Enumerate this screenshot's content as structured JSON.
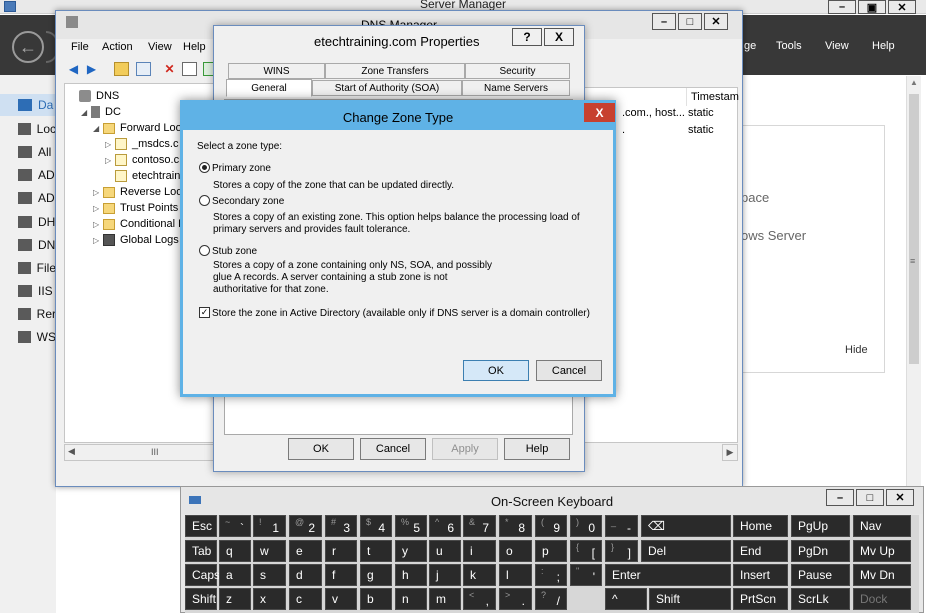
{
  "server_manager": {
    "title": "Server Manager",
    "menus": [
      "ge",
      "Tools",
      "View",
      "Help"
    ],
    "sidebar": [
      {
        "label": "Da",
        "icon": "dashboard-icon",
        "active": true
      },
      {
        "label": "Loc",
        "icon": "local-server-icon"
      },
      {
        "label": "All",
        "icon": "all-servers-icon"
      },
      {
        "label": "AD",
        "icon": "ad-cs-icon"
      },
      {
        "label": "AD",
        "icon": "ad-ds-icon"
      },
      {
        "label": "DH",
        "icon": "dhcp-icon"
      },
      {
        "label": "DN",
        "icon": "dns-icon"
      },
      {
        "label": "File",
        "icon": "file-services-icon"
      },
      {
        "label": "IIS",
        "icon": "iis-icon"
      },
      {
        "label": "Rer",
        "icon": "remote-access-icon"
      },
      {
        "label": "WS",
        "icon": "wsus-icon"
      }
    ],
    "tile": {
      "line1": "pace",
      "line2": "ows Server",
      "hide": "Hide"
    }
  },
  "dns_manager": {
    "title": "DNS Manager",
    "menus": [
      "File",
      "Action",
      "View",
      "Help"
    ],
    "tree": [
      {
        "label": "DNS",
        "indent": 0,
        "twisty": "",
        "icon": "dns"
      },
      {
        "label": "DC",
        "indent": 1,
        "twisty": "◢",
        "icon": "server"
      },
      {
        "label": "Forward Look",
        "indent": 2,
        "twisty": "◢",
        "icon": "folder"
      },
      {
        "label": "_msdcs.c",
        "indent": 3,
        "twisty": "▷",
        "icon": "zone"
      },
      {
        "label": "contoso.c",
        "indent": 3,
        "twisty": "▷",
        "icon": "zone"
      },
      {
        "label": "etechtrain",
        "indent": 3,
        "twisty": "",
        "icon": "zone"
      },
      {
        "label": "Reverse Look",
        "indent": 2,
        "twisty": "▷",
        "icon": "folder"
      },
      {
        "label": "Trust Points",
        "indent": 2,
        "twisty": "▷",
        "icon": "folder"
      },
      {
        "label": "Conditional F",
        "indent": 2,
        "twisty": "▷",
        "icon": "folder"
      },
      {
        "label": "Global Logs",
        "indent": 2,
        "twisty": "▷",
        "icon": "logs"
      }
    ],
    "list": {
      "header": "Timestam",
      "rows": [
        {
          "data": ".com., host...",
          "timestamp": "static"
        },
        {
          "data": ".",
          "timestamp": "static"
        }
      ]
    }
  },
  "properties": {
    "title": "etechtraining.com Properties",
    "tabs_row1": [
      "WINS",
      "Zone Transfers",
      "Security"
    ],
    "tabs_row2": [
      "General",
      "Start of Authority (SOA)",
      "Name Servers"
    ],
    "selected_tab": "General",
    "help_button": "?",
    "close_button": "X",
    "buttons": {
      "ok": "OK",
      "cancel": "Cancel",
      "apply": "Apply",
      "help": "Help"
    }
  },
  "change_zone": {
    "title": "Change Zone Type",
    "close": "X",
    "prompt": "Select a zone type:",
    "options": [
      {
        "label": "Primary zone",
        "selected": true,
        "desc": [
          "Stores a copy of the zone that can be updated directly."
        ]
      },
      {
        "label": "Secondary zone",
        "selected": false,
        "desc": [
          "Stores a copy of an existing zone. This option helps balance the processing load of",
          "primary servers and provides fault tolerance."
        ]
      },
      {
        "label": "Stub zone",
        "selected": false,
        "desc": [
          "Stores a copy of a zone containing only NS, SOA, and possibly",
          "glue A records. A server containing a stub zone is not",
          "authoritative for that zone."
        ]
      }
    ],
    "ad_checkbox": {
      "label": "Store the zone in Active Directory (available only if DNS server is a domain controller)",
      "checked": true
    },
    "ok": "OK",
    "cancel": "Cancel"
  },
  "keyboard": {
    "title": "On-Screen Keyboard",
    "rows": [
      [
        {
          "l": "Esc"
        },
        {
          "s": "~",
          "m": "`"
        },
        {
          "s": "!",
          "m": "1"
        },
        {
          "s": "@",
          "m": "2"
        },
        {
          "s": "#",
          "m": "3"
        },
        {
          "s": "$",
          "m": "4"
        },
        {
          "s": "%",
          "m": "5"
        },
        {
          "s": "^",
          "m": "6"
        },
        {
          "s": "&",
          "m": "7"
        },
        {
          "s": "*",
          "m": "8"
        },
        {
          "s": "(",
          "m": "9"
        },
        {
          "s": ")",
          "m": "0"
        },
        {
          "s": "_",
          "m": "-"
        },
        {
          "s": "+",
          "m": "="
        },
        {
          "l": "⌫"
        },
        {
          "l": "Home"
        },
        {
          "l": "PgUp"
        },
        {
          "l": "Nav"
        }
      ],
      [
        {
          "l": "Tab"
        },
        {
          "l": "q"
        },
        {
          "l": "w"
        },
        {
          "l": "e"
        },
        {
          "l": "r"
        },
        {
          "l": "t"
        },
        {
          "l": "y"
        },
        {
          "l": "u"
        },
        {
          "l": "i"
        },
        {
          "l": "o"
        },
        {
          "l": "p"
        },
        {
          "s": "{",
          "m": "["
        },
        {
          "s": "}",
          "m": "]"
        },
        {
          "s": "|",
          "m": "\\"
        },
        {
          "l": "Del"
        },
        {
          "l": "End"
        },
        {
          "l": "PgDn"
        },
        {
          "l": "Mv Up"
        }
      ],
      [
        {
          "l": "Caps"
        },
        {
          "l": "a"
        },
        {
          "l": "s"
        },
        {
          "l": "d"
        },
        {
          "l": "f"
        },
        {
          "l": "g"
        },
        {
          "l": "h"
        },
        {
          "l": "j"
        },
        {
          "l": "k"
        },
        {
          "l": "l"
        },
        {
          "s": ":",
          "m": ";"
        },
        {
          "s": "\"",
          "m": "'"
        },
        {
          "l": "Enter"
        },
        {
          "l": "Insert"
        },
        {
          "l": "Pause"
        },
        {
          "l": "Mv Dn"
        }
      ],
      [
        {
          "l": "Shift"
        },
        {
          "l": "z"
        },
        {
          "l": "x"
        },
        {
          "l": "c"
        },
        {
          "l": "v"
        },
        {
          "l": "b"
        },
        {
          "l": "n"
        },
        {
          "l": "m"
        },
        {
          "s": "<",
          "m": ","
        },
        {
          "s": ">",
          "m": "."
        },
        {
          "s": "?",
          "m": "/"
        },
        {
          "l": "^"
        },
        {
          "l": "Shift"
        },
        {
          "l": "PrtScn"
        },
        {
          "l": "ScrLk"
        },
        {
          "l": "Dock",
          "dim": true
        }
      ]
    ]
  },
  "colors": {
    "dialog_frame": "#5fb2e6",
    "close_red": "#c7402f",
    "sm_bar": "#383838",
    "key_bg": "#2a2a2a"
  }
}
